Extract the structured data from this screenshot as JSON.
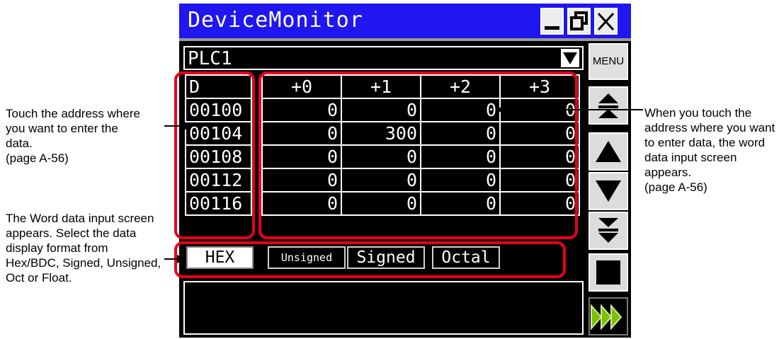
{
  "window": {
    "title": "DeviceMonitor"
  },
  "device_select": {
    "value": "PLC1"
  },
  "menu_label": "MENU",
  "table": {
    "columns": [
      "D",
      "+0",
      "+1",
      "+2",
      "+3"
    ],
    "rows": [
      {
        "addr": "00100",
        "values": [
          "0",
          "0",
          "0",
          "0"
        ]
      },
      {
        "addr": "00104",
        "values": [
          "0",
          "300",
          "0",
          "0"
        ]
      },
      {
        "addr": "00108",
        "values": [
          "0",
          "0",
          "0",
          "0"
        ]
      },
      {
        "addr": "00112",
        "values": [
          "0",
          "0",
          "0",
          "0"
        ]
      },
      {
        "addr": "00116",
        "values": [
          "0",
          "0",
          "0",
          "0"
        ]
      }
    ]
  },
  "formats": {
    "hex": "HEX",
    "unsigned": "Unsigned",
    "signed": "Signed",
    "octal": "Octal"
  },
  "annotations": {
    "touch_address": "Touch the address where you want to enter the data.\n (page A-56)",
    "word_input": "The Word data input screen appears. Select the data display format from Hex/BDC, Signed, Unsigned, Oct or Float.",
    "when_touch": "When you touch the address where you want to enter data, the word data input screen appears.\n (page A-56)"
  },
  "colors": {
    "title_bar": "#1f16f0",
    "highlight": "#e8001c",
    "run_arrow": "#7cc000"
  },
  "icons": [
    "minimize-icon",
    "maximize-icon",
    "close-icon",
    "dropdown-arrow-icon",
    "scroll-top-icon",
    "scroll-up-icon",
    "scroll-down-icon",
    "scroll-bottom-icon",
    "stop-icon",
    "run-icon"
  ]
}
